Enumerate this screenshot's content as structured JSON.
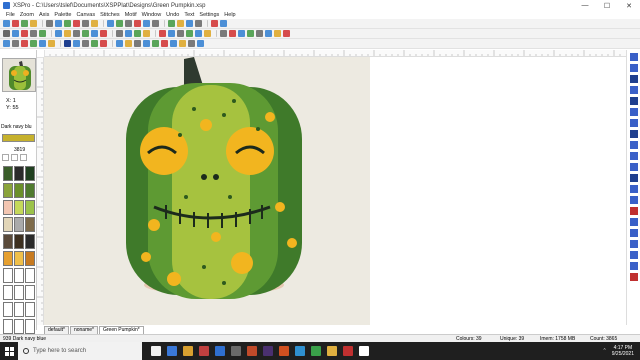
{
  "window": {
    "title": "XSPro - C:\\Users\\tslef\\Documents\\XSPPlat\\Designs\\Green Pumpkin.xsp",
    "controls": [
      "—",
      "☐",
      "✕"
    ]
  },
  "menu": [
    "File",
    "Zoom",
    "Axis",
    "Palette",
    "Canvas",
    "Stitches",
    "Motif",
    "Window",
    "Undo",
    "Text",
    "Settings",
    "Help"
  ],
  "toolbar_rows": [
    [
      "#4c8fd6",
      "#d64c4c",
      "#5aa55a",
      "#e0b040",
      "sep",
      "#7a7a7a",
      "#4c8fd6",
      "#5aa55a",
      "#d64c4c",
      "#7a7a7a",
      "#e0b040",
      "sep",
      "#4c8fd6",
      "#5aa55a",
      "#7a7a7a",
      "#d64c4c",
      "#4c8fd6",
      "#7a7a7a",
      "sep",
      "#5aa55a",
      "#e0b040",
      "#4c8fd6",
      "#7a7a7a",
      "sep",
      "#d64c4c",
      "#4c8fd6"
    ],
    [
      "#6a6a6a",
      "#4c8fd6",
      "#d64c4c",
      "#7a7a7a",
      "#5aa55a",
      "sep",
      "#4c8fd6",
      "#e0b040",
      "#7a7a7a",
      "#5aa55a",
      "#4c8fd6",
      "#d64c4c",
      "sep",
      "#7a7a7a",
      "#4c8fd6",
      "#5aa55a",
      "#e0b040",
      "sep",
      "#d64c4c",
      "#4c8fd6",
      "#7a7a7a",
      "#5aa55a",
      "#4c8fd6",
      "#e0b040",
      "sep",
      "#7a7a7a",
      "#d64c4c",
      "#4c8fd6",
      "#5aa55a",
      "#7a7a7a",
      "#4c8fd6",
      "#e0b040",
      "#d64c4c"
    ],
    [
      "#4c8fd6",
      "#7a7a7a",
      "#d64c4c",
      "#5aa55a",
      "#4c8fd6",
      "#e0b040",
      "sep",
      "#1f3f8f",
      "#4c8fd6",
      "#7a7a7a",
      "#5aa55a",
      "#d64c4c",
      "sep",
      "#4c8fd6",
      "#e0b040",
      "#7a7a7a",
      "#4c8fd6",
      "#5aa55a",
      "#d64c4c",
      "#4c8fd6",
      "#e0b040",
      "#7a7a7a",
      "#4c8fd6"
    ]
  ],
  "cursor": {
    "x_label": "X:",
    "x_value": "1",
    "y_label": "Y:",
    "y_value": "55"
  },
  "selected_color": {
    "name": "Dark navy blu",
    "code": "3819",
    "hex": "#c6b12c"
  },
  "palette": [
    "#3a5d2a",
    "#2a2a2a",
    "#1f3f1f",
    "#8aa33a",
    "#6b8f2a",
    "#4f7a2f",
    "#f3c6b2",
    "#c5d85a",
    "#9bc24a",
    "#e2d6b8",
    "#aaaaaa",
    "#7d6a4a",
    "#5a4a3a",
    "#3d3020",
    "#2b2b2b",
    "#e6a030",
    "#f0c04a",
    "#c77a20",
    "#ffffff",
    "#ffffff",
    "#ffffff",
    "#ffffff",
    "#ffffff",
    "#ffffff",
    "#ffffff",
    "#ffffff",
    "#ffffff",
    "#ffffff",
    "#ffffff",
    "#ffffff"
  ],
  "tabs": [
    "default*",
    "noname*",
    "Green Pumpkin*"
  ],
  "status": {
    "color": "939 Dark navy blue",
    "colours": "Colours: 39",
    "unique": "Unique: 39",
    "mem": "Imem: 1758 MB",
    "count": "Count: 3865"
  },
  "taskbar": {
    "search_placeholder": "Type here to search",
    "apps": [
      "#f0f0f0",
      "#3a78d8",
      "#d8a030",
      "#c04040",
      "#2f6fd0",
      "#6a6a6a",
      "#c04a2a",
      "#4a3070",
      "#d05020",
      "#2f90d0",
      "#3aa04a",
      "#e0b040",
      "#c03030",
      "#ffffff"
    ],
    "time": "4:17 PM",
    "date": "9/25/2021"
  }
}
